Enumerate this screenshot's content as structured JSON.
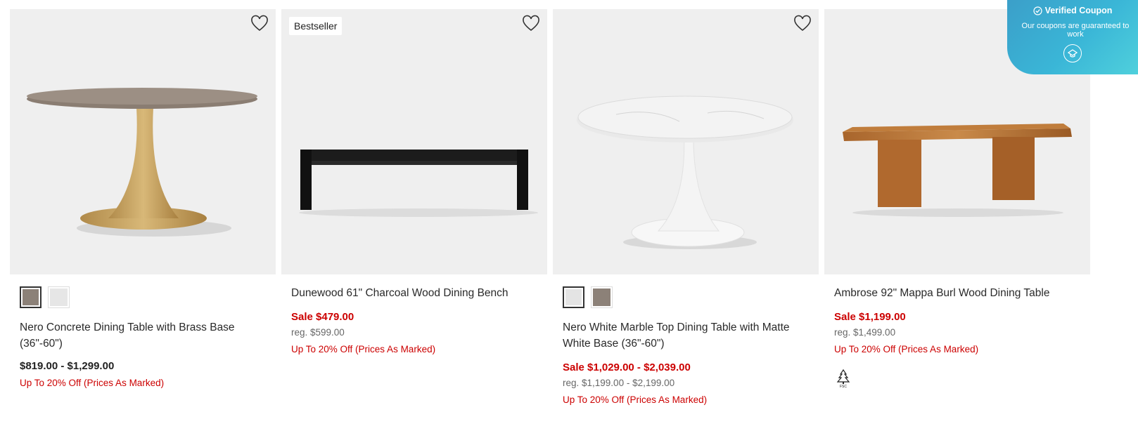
{
  "products": [
    {
      "name": "Nero Concrete Dining Table with Brass Base (36\"-60\")",
      "price": "$819.00 - $1,299.00",
      "promo": "Up To 20% Off (Prices As Marked)",
      "swatches": [
        "#8c8178",
        "#e6e6e6"
      ]
    },
    {
      "badge": "Bestseller",
      "name": "Dunewood 61\" Charcoal Wood Dining Bench",
      "sale": "Sale $479.00",
      "reg": "reg. $599.00",
      "promo": "Up To 20% Off (Prices As Marked)"
    },
    {
      "name": "Nero White Marble Top Dining Table with Matte White Base (36\"-60\")",
      "sale": "Sale $1,029.00 - $2,039.00",
      "reg": "reg. $1,199.00 - $2,199.00",
      "promo": "Up To 20% Off (Prices As Marked)",
      "swatches": [
        "#e4e4e4",
        "#8c8178"
      ]
    },
    {
      "name": "Ambrose 92\" Mappa Burl Wood Dining Table",
      "sale": "Sale $1,199.00",
      "reg": "reg. $1,499.00",
      "promo": "Up To 20% Off (Prices As Marked)",
      "certification_icon": "fsc-tree-icon"
    }
  ],
  "coupon": {
    "title": "Verified Coupon",
    "subtitle": "Our coupons are guaranteed to work"
  },
  "colors": {
    "sale": "#cc0000",
    "coupon_gradient_start": "#3b9fc9",
    "coupon_gradient_end": "#4fd0dc"
  }
}
